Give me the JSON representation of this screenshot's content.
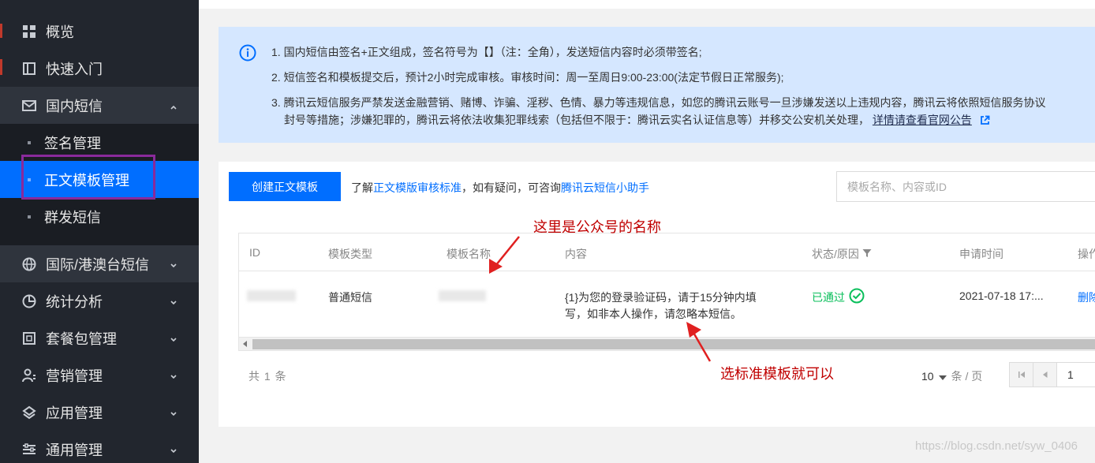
{
  "sidebar": {
    "items": [
      {
        "label": "概览",
        "icon": "grid-icon"
      },
      {
        "label": "快速入门",
        "icon": "book-icon"
      },
      {
        "label": "国内短信",
        "icon": "mail-icon",
        "expanded": true
      },
      {
        "label": "国际/港澳台短信",
        "icon": "globe-icon"
      },
      {
        "label": "统计分析",
        "icon": "pie-chart-icon"
      },
      {
        "label": "套餐包管理",
        "icon": "package-icon"
      },
      {
        "label": "营销管理",
        "icon": "users-icon"
      },
      {
        "label": "应用管理",
        "icon": "layers-icon"
      },
      {
        "label": "通用管理",
        "icon": "sliders-icon"
      }
    ],
    "subitems": [
      {
        "label": "签名管理"
      },
      {
        "label": "正文模板管理",
        "active": true
      },
      {
        "label": "群发短信"
      }
    ]
  },
  "notice": {
    "line1": "1. 国内短信由签名+正文组成，签名符号为【】（注：全角），发送短信内容时必须带签名;",
    "line2": "2. 短信签名和模板提交后，预计2小时完成审核。审核时间：周一至周日9:00-23:00(法定节假日正常服务);",
    "line3": "3. 腾讯云短信服务严禁发送金融营销、赌博、诈骗、淫秽、色情、暴力等违规信息，如您的腾讯云账号一旦涉嫌发送以上违规内容，腾讯云将依照短信服务协议",
    "line4_text": "封号等措施；涉嫌犯罪的，腾讯云将依法收集犯罪线索（包括但不限于：腾讯云实名认证信息等）并移交公安机关处理，",
    "line4_link": "详情请查看官网公告"
  },
  "toolbar": {
    "create_label": "创建正文模板",
    "help_prefix": "了解",
    "help_link1": "正文模版审核标准",
    "help_mid": "，如有疑问，可咨询",
    "help_link2": "腾讯云短信小助手",
    "search_placeholder": "模板名称、内容或ID"
  },
  "table": {
    "headers": [
      "ID",
      "模板类型",
      "模板名称",
      "内容",
      "状态/原因",
      "申请时间",
      "操作"
    ],
    "rows": [
      {
        "type": "普通短信",
        "content_line1": "{1}为您的登录验证码，请于15分钟内填",
        "content_line2": "写，如非本人操作，请忽略本短信。",
        "status": "已通过",
        "time": "2021-07-18 17:...",
        "action": "删除"
      }
    ]
  },
  "pagination": {
    "total_text": "共 1 条",
    "page_size": "10",
    "page_size_unit": "条 / 页",
    "current_page": "1"
  },
  "annotations": {
    "name_note": "这里是公众号的名称",
    "template_note": "选标准模板就可以"
  },
  "watermark": "https://blog.csdn.net/syw_0406",
  "colors": {
    "sidebar_bg": "#22262e",
    "accent": "#006eff",
    "notice_bg": "#d5e7ff",
    "success": "#0abf5b",
    "annotation": "#c00000",
    "highlight_box": "#8a2a9b"
  }
}
